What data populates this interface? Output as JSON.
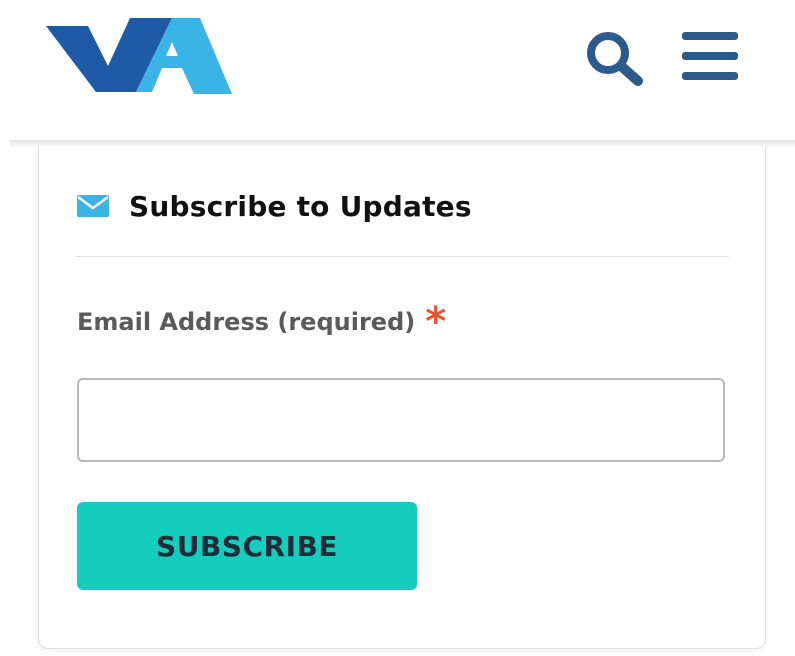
{
  "header": {
    "logo_icon": "vta-logo",
    "logo_colors": {
      "dark": "#1f5aa6",
      "light": "#3ab3e6"
    },
    "search_icon": "search-icon",
    "menu_icon": "hamburger-menu-icon",
    "icon_color": "#2b5b8a"
  },
  "subscribe_card": {
    "title_icon": "envelope-icon",
    "title": "Subscribe to Updates",
    "email_label": "Email Address (required)",
    "required_mark": "*",
    "email_value": "",
    "button_label": "SUBSCRIBE",
    "button_color": "#14cdbd"
  }
}
